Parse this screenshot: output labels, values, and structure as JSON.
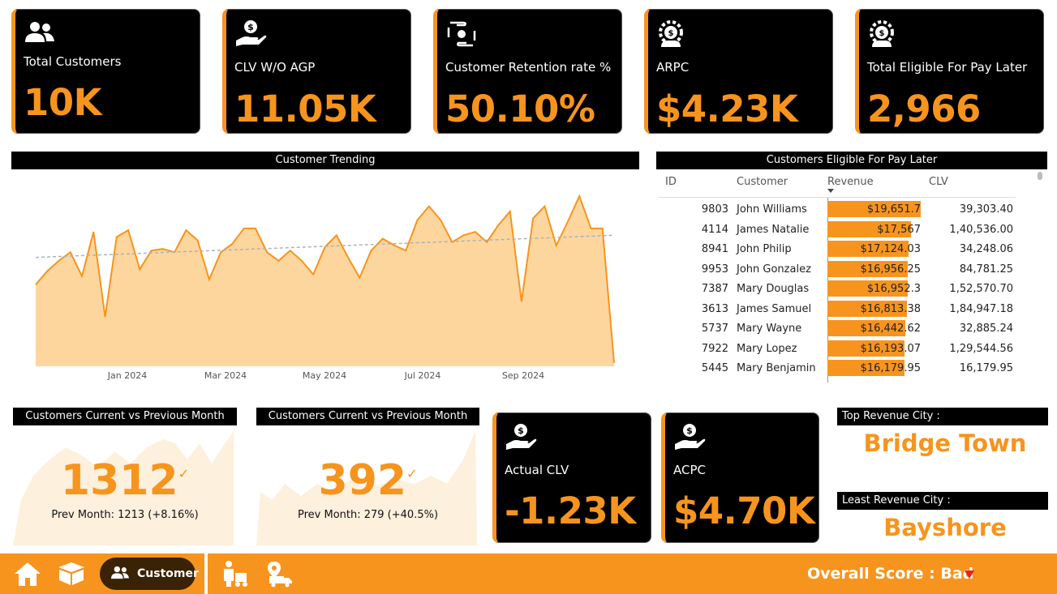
{
  "kpis": [
    {
      "icon": "users-icon",
      "label": "Total Customers",
      "value": "10K"
    },
    {
      "icon": "hand-dollar-icon",
      "label": "CLV W/O AGP",
      "value": "11.05K"
    },
    {
      "icon": "retention-hands-icon",
      "label": "Customer Retention rate %",
      "value": "50.10%"
    },
    {
      "icon": "person-gear-dollar-icon",
      "label": "ARPC",
      "value": "$4.23K"
    },
    {
      "icon": "person-gear-dollar-icon",
      "label": "Total Eligible For Pay Later",
      "value": "2,966"
    }
  ],
  "trend": {
    "title": "Customer Trending",
    "x_labels": [
      "Jan 2024",
      "Mar 2024",
      "May 2024",
      "Jul 2024",
      "Sep 2024"
    ]
  },
  "chart_data": {
    "type": "area",
    "title": "Customer Trending",
    "xlabel": "",
    "ylabel": "",
    "tick_labels": [
      "Jan 2024",
      "Mar 2024",
      "May 2024",
      "Jul 2024",
      "Sep 2024"
    ],
    "grid": false,
    "trendline": true,
    "values": [
      0.48,
      0.56,
      0.62,
      0.67,
      0.53,
      0.79,
      0.29,
      0.76,
      0.8,
      0.57,
      0.68,
      0.69,
      0.67,
      0.8,
      0.74,
      0.51,
      0.67,
      0.72,
      0.81,
      0.81,
      0.67,
      0.62,
      0.68,
      0.62,
      0.54,
      0.7,
      0.77,
      0.64,
      0.52,
      0.68,
      0.75,
      0.71,
      0.68,
      0.86,
      0.94,
      0.86,
      0.73,
      0.77,
      0.79,
      0.73,
      0.83,
      0.91,
      0.38,
      0.87,
      0.94,
      0.71,
      0.85,
      1.0,
      0.81,
      0.81,
      0.02
    ],
    "trend_start": 0.64,
    "trend_end": 0.77
  },
  "table": {
    "title": "Customers Eligible For Pay Later",
    "headers": {
      "id": "ID",
      "customer": "Customer",
      "revenue": "Revenue",
      "clv": "CLV"
    },
    "rows": [
      {
        "id": "9803",
        "customer": "John Williams",
        "revenue": "$19,651.7",
        "rev_frac": 1.0,
        "clv": "39,303.40"
      },
      {
        "id": "4114",
        "customer": "James Natalie",
        "revenue": "$17,567",
        "rev_frac": 0.894,
        "clv": "1,40,536.00"
      },
      {
        "id": "8941",
        "customer": "John Philip",
        "revenue": "$17,124.03",
        "rev_frac": 0.871,
        "clv": "34,248.06"
      },
      {
        "id": "9953",
        "customer": "John Gonzalez",
        "revenue": "$16,956.25",
        "rev_frac": 0.863,
        "clv": "84,781.25"
      },
      {
        "id": "7387",
        "customer": "Mary Douglas",
        "revenue": "$16,952.3",
        "rev_frac": 0.863,
        "clv": "1,52,570.70"
      },
      {
        "id": "3613",
        "customer": "James Samuel",
        "revenue": "$16,813.38",
        "rev_frac": 0.856,
        "clv": "1,84,947.18"
      },
      {
        "id": "5737",
        "customer": "Mary Wayne",
        "revenue": "$16,442.62",
        "rev_frac": 0.837,
        "clv": "32,885.24"
      },
      {
        "id": "7922",
        "customer": "Mary Lopez",
        "revenue": "$16,193.07",
        "rev_frac": 0.824,
        "clv": "1,29,544.56"
      },
      {
        "id": "5445",
        "customer": "Mary Benjamin",
        "revenue": "$16,179.95",
        "rev_frac": 0.823,
        "clv": "16,179.95"
      }
    ]
  },
  "cmp": [
    {
      "title": "Customers Current vs Previous Month",
      "value": "1312",
      "check": "✓",
      "sub": "Prev Month: 1213 (+8.16%)"
    },
    {
      "title": "Customers Current vs Previous Month",
      "value": "392",
      "check": "✓",
      "sub": "Prev Month: 279 (+40.5%)"
    }
  ],
  "small_kpis": [
    {
      "icon": "hand-dollar-icon",
      "label": "Actual CLV",
      "value": "-1.23K"
    },
    {
      "icon": "hand-dollar-icon",
      "label": "ACPC",
      "value": "$4.70K"
    }
  ],
  "cities": {
    "top_title": "Top Revenue City :",
    "top_value": "Bridge Town",
    "least_title": "Least Revenue City :",
    "least_value": "Bayshore"
  },
  "footer": {
    "nav_active": "Customer",
    "score": "Overall Score : Bad"
  },
  "colors": {
    "accent": "#F7941D",
    "area_fill": "#FDD69E",
    "bad": "#E8211C",
    "pill": "#3a2205"
  }
}
